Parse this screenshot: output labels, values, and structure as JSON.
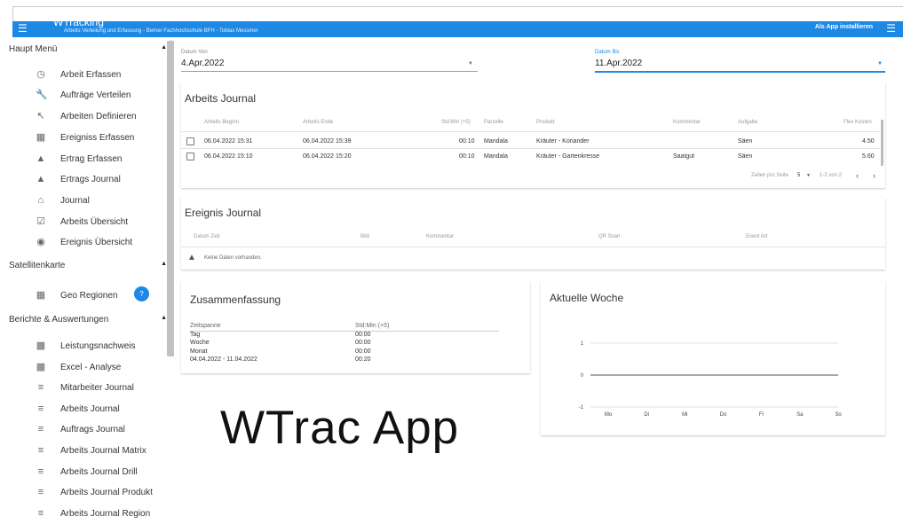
{
  "app_bar": {
    "title": "WTracking",
    "subtitle": "Arbeits Verteilung und Erfassung - Berner Fachhochschule BFH - Tobias Messmer",
    "install_label": "Als App installieren",
    "menu_icon": "hamburger-icon"
  },
  "sidebar": {
    "sections": [
      {
        "label": "Haupt Menü",
        "items": [
          {
            "label": "Arbeit Erfassen",
            "icon": "clock-icon"
          },
          {
            "label": "Aufträge Verteilen",
            "icon": "wrench-icon"
          },
          {
            "label": "Arbeiten Definieren",
            "icon": "arrow-icon"
          },
          {
            "label": "Ereigniss Erfassen",
            "icon": "camera-plus-icon"
          },
          {
            "label": "Ertrag Erfassen",
            "icon": "basket-icon"
          },
          {
            "label": "Ertrags Journal",
            "icon": "basket-icon"
          },
          {
            "label": "Journal",
            "icon": "home-icon"
          },
          {
            "label": "Arbeits Übersicht",
            "icon": "clipboard-check-icon"
          },
          {
            "label": "Ereignis Übersicht",
            "icon": "camera-icon"
          }
        ]
      },
      {
        "label": "Satellitenkarte",
        "items": [
          {
            "label": "Geo Regionen",
            "icon": "map-grid-icon",
            "badge": "help-icon"
          }
        ]
      },
      {
        "label": "Berichte & Auswertungen",
        "items": [
          {
            "label": "Leistungsnachweis",
            "icon": "bar-chart-icon"
          },
          {
            "label": "Excel - Analyse",
            "icon": "bar-chart-icon"
          },
          {
            "label": "Mitarbeiter Journal",
            "icon": "list-icon"
          },
          {
            "label": "Arbeits Journal",
            "icon": "list-icon"
          },
          {
            "label": "Auftrags Journal",
            "icon": "list-icon"
          },
          {
            "label": "Arbeits Journal Matrix",
            "icon": "list-icon"
          },
          {
            "label": "Arbeits Journal Drill",
            "icon": "list-icon"
          },
          {
            "label": "Arbeits Journal Produkt",
            "icon": "list-icon"
          },
          {
            "label": "Arbeits Journal Region",
            "icon": "list-icon"
          }
        ]
      }
    ]
  },
  "filters": {
    "from_label": "Datum Von",
    "from_value": "4.Apr.2022",
    "to_label": "Datum Bis",
    "to_value": "11.Apr.2022"
  },
  "arbeits_journal": {
    "title": "Arbeits Journal",
    "columns": [
      "Arbeits Beginn",
      "Arbeits Ende",
      "Std:Min (+5)",
      "Parzelle",
      "Produkt",
      "Kommentar",
      "Aufgabe",
      "Flex Kosten"
    ],
    "rows": [
      [
        "06.04.2022 15:31",
        "06.04.2022 15:39",
        "00:10",
        "Mandala",
        "Kräuter - Koriander",
        "",
        "Säen",
        "4.50"
      ],
      [
        "06.04.2022 15:10",
        "06.04.2022 15:20",
        "00:10",
        "Mandala",
        "Kräuter - Gartenkresse",
        "Saatgut",
        "Säen",
        "5.60"
      ]
    ],
    "pagination": {
      "rows_per_page_label": "Zeilen pro Seite",
      "rows_per_page": "5",
      "range": "1-2 von 2"
    }
  },
  "ereignis_journal": {
    "title": "Ereignis Journal",
    "columns": [
      "Datum Zeit",
      "Bild",
      "Kommentar",
      "QR Scan",
      "Event Art"
    ],
    "empty_text": "Keine Daten vorhanden."
  },
  "zusammenfassung": {
    "title": "Zusammenfassung",
    "header": [
      "Zeitspanne",
      "Std:Min (+5)"
    ],
    "rows": [
      [
        "Tag",
        "00:00"
      ],
      [
        "Woche",
        "00:00"
      ],
      [
        "Monat",
        "00:00"
      ],
      [
        "04.04.2022 - 11.04.2022",
        "00:20"
      ]
    ]
  },
  "aktuelle_woche": {
    "title": "Aktuelle Woche"
  },
  "chart_data": {
    "type": "line",
    "categories": [
      "Mo",
      "Di",
      "Mi",
      "Do",
      "Fr",
      "Sa",
      "So"
    ],
    "series": [
      {
        "values": [
          0,
          0,
          0,
          0,
          0,
          0,
          0
        ]
      }
    ],
    "ylim": [
      -1,
      1
    ],
    "yticks": [
      "1",
      "0",
      "-1"
    ],
    "title": "",
    "xlabel": "",
    "ylabel": ""
  },
  "overlay_text": "WTrac App",
  "colors": {
    "primary": "#1e88e5",
    "text": "#333333"
  }
}
